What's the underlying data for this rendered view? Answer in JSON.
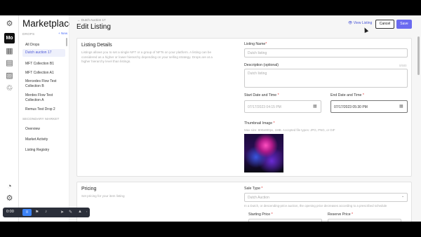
{
  "rail": {
    "workspace_badge": "Mo",
    "icons": [
      "logo-icon",
      "grid-icon",
      "calendar-icon",
      "image-icon",
      "recycle-icon",
      "chart-icon",
      "settings-icon"
    ]
  },
  "sidebar": {
    "title": "Marketplace",
    "drops_header": "DROPS",
    "new_label": "+ New",
    "items": [
      {
        "label": "All Drops"
      },
      {
        "label": "Dutch auction 17"
      },
      {
        "label": "MFT Collection B1"
      },
      {
        "label": "MFT Collection A1"
      },
      {
        "label": "Mercedes Flow Test"
      },
      {
        "label": "Collection B"
      },
      {
        "label": "Merdes Flow Test"
      },
      {
        "label": "Collection A"
      },
      {
        "label": "Remus Test Drop 2"
      }
    ],
    "secondary_header": "SECONDARY MARKET",
    "secondary_items": [
      {
        "label": "Overview"
      },
      {
        "label": "Market Activity"
      },
      {
        "label": "Listing Registry"
      }
    ]
  },
  "header": {
    "breadcrumb": "← Dutch Auction 17",
    "title": "Edit Listing",
    "view_listing": "View Listing",
    "cancel": "Cancel",
    "save": "Save"
  },
  "listing_details": {
    "heading": "Listing Details",
    "description": "Listings allows you to set a single NFT or a group of NFTs on your platform. A listing can be considered as a higher or lower hierarchy depending on your selling strategy. Drops are at a higher hierarchy level than listings.",
    "name_label": "Listing Name",
    "name_placeholder": "Dutch listing",
    "desc_label": "Description (optional)",
    "desc_placeholder": "Dutch listing",
    "desc_hint": "0/500",
    "start_label": "Start Date and Time",
    "start_value": "07/17/2023 04:15 PM",
    "end_label": "End Date and Time",
    "end_value": "07/17/2023 05:30 PM",
    "thumb_label": "Thumbnail Image",
    "thumb_hint": "Max size: 800x800px, 1MB. Accepted file types: JPG, PNG, or GIF"
  },
  "pricing": {
    "heading": "Pricing",
    "description": "Set pricing for your item listing",
    "sale_type_label": "Sale Type",
    "sale_type_value": "Dutch Auction",
    "sale_type_hint": "In a Dutch, or descending-price auction, the opening price decreases according to a prescribed schedule",
    "starting_price_label": "Starting Price",
    "reserve_price_label": "Reserve Price"
  },
  "toolbar": {
    "time": "0:00",
    "pause_label": "II"
  },
  "colors": {
    "accent": "#6b6bf0",
    "link": "#4a56d6",
    "required": "#d33333"
  }
}
